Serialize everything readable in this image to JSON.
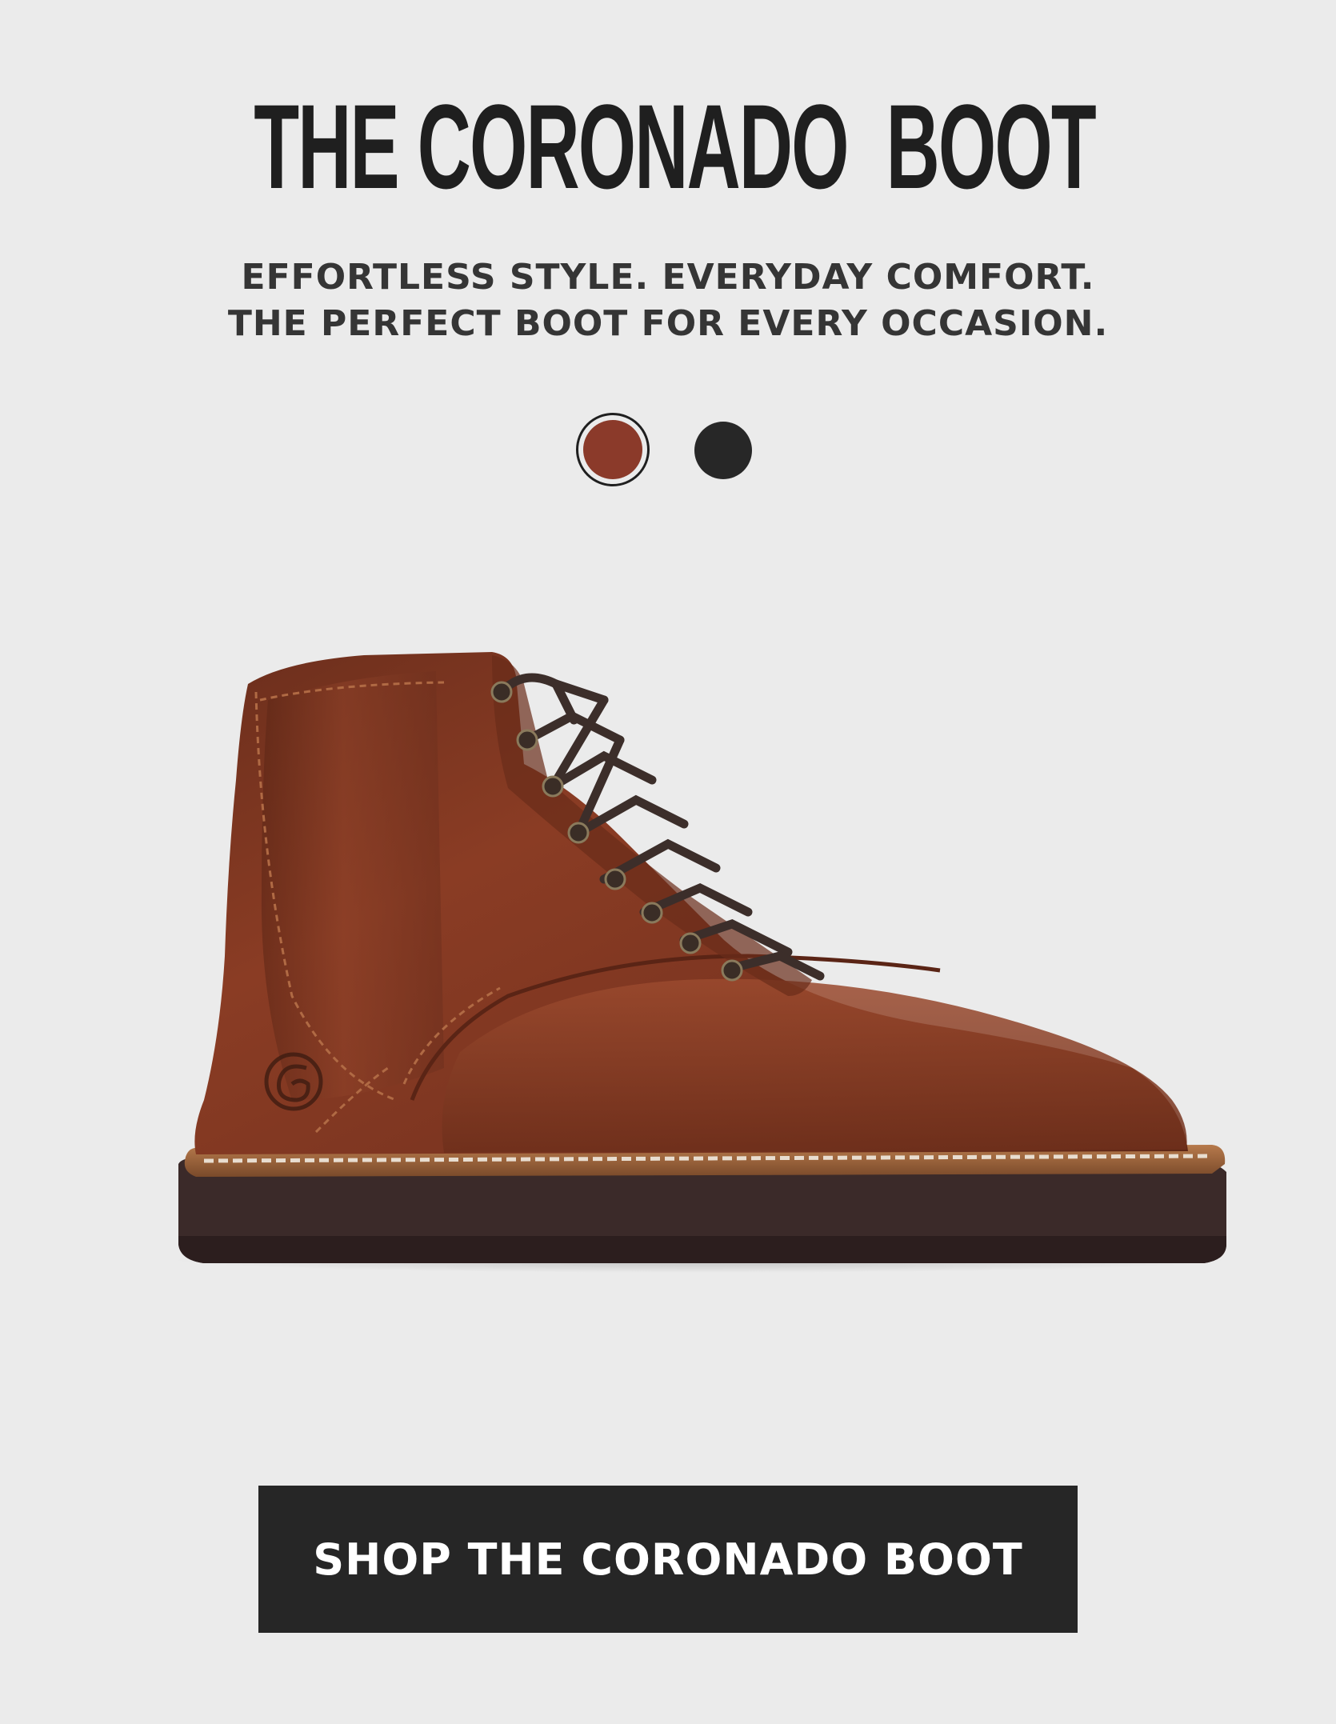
{
  "hero": {
    "title": "THE CORONADO  BOOT",
    "subtitle_line1": "EFFORTLESS STYLE. EVERYDAY COMFORT.",
    "subtitle_line2": "THE PERFECT BOOT FOR EVERY OCCASION."
  },
  "color_options": [
    {
      "color": "#8b3a2a",
      "selected": true
    },
    {
      "color": "#272727",
      "selected": false
    }
  ],
  "product_image": {
    "icon": "boot-image",
    "leather_color": "#7e3622",
    "sole_color": "#3a2a2a",
    "lace_color": "#3c2e2a"
  },
  "cta": {
    "label": "SHOP THE CORONADO BOOT",
    "background": "#262626",
    "text_color": "#ffffff"
  },
  "colors": {
    "background": "#ebebeb",
    "title": "#1f1f1f",
    "subtitle": "#353535"
  }
}
